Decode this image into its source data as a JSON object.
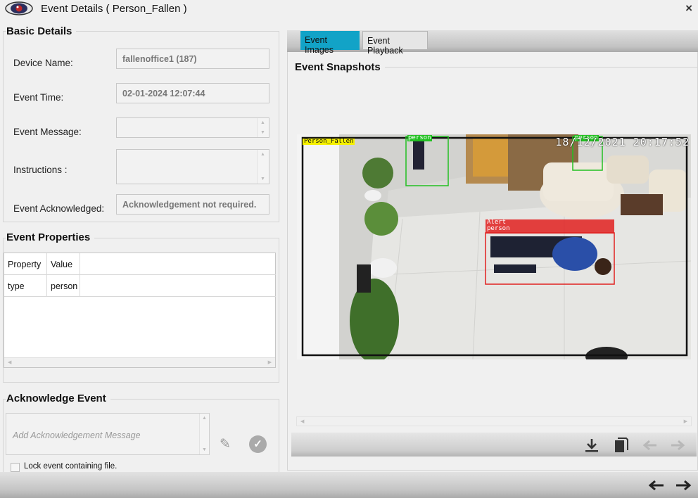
{
  "window": {
    "title": "Event Details ( Person_Fallen )",
    "close_label": "×"
  },
  "basic_details": {
    "section_title": "Basic Details",
    "device_name_label": "Device Name:",
    "device_name_value": "fallenoffice1 (187)",
    "event_time_label": "Event Time:",
    "event_time_value": "02-01-2024 12:07:44",
    "event_message_label": "Event Message:",
    "event_message_value": "",
    "instructions_label": "Instructions :",
    "instructions_value": "",
    "event_ack_label": "Event Acknowledged:",
    "event_ack_value": "Acknowledgement not required."
  },
  "event_properties": {
    "section_title": "Event Properties",
    "columns": [
      "Property",
      "Value"
    ],
    "rows": [
      {
        "property": "type",
        "value": "person"
      }
    ]
  },
  "acknowledge_event": {
    "section_title": "Acknowledge Event",
    "message_placeholder": "Add Acknowledgement Message",
    "lock_label": "Lock event containing file.",
    "lock_checked": false
  },
  "tabs": [
    {
      "label": "Event Images",
      "active": true
    },
    {
      "label": "Event Playback",
      "active": false
    }
  ],
  "snapshots": {
    "section_title": "Event Snapshots",
    "timestamp_overlay": "18/12/2021 20:17:52",
    "detections": [
      {
        "label": "Person_Fallen",
        "color": "#f5f000"
      },
      {
        "label": "person",
        "color": "#22c022"
      },
      {
        "label": "person",
        "color": "#22c022"
      },
      {
        "label": "Alert",
        "color": "#e02020"
      },
      {
        "label": "person",
        "color": "#e02020"
      }
    ]
  },
  "toolbar_icons": [
    "download-icon",
    "copy-icon",
    "previous-snapshot-icon",
    "next-snapshot-icon"
  ],
  "footer_icons": [
    "previous-event-icon",
    "next-event-icon"
  ],
  "colors": {
    "active_tab": "#12a3c7",
    "alert_box": "#e02020",
    "person_box": "#22c022",
    "fallen_box": "#f5f000"
  }
}
